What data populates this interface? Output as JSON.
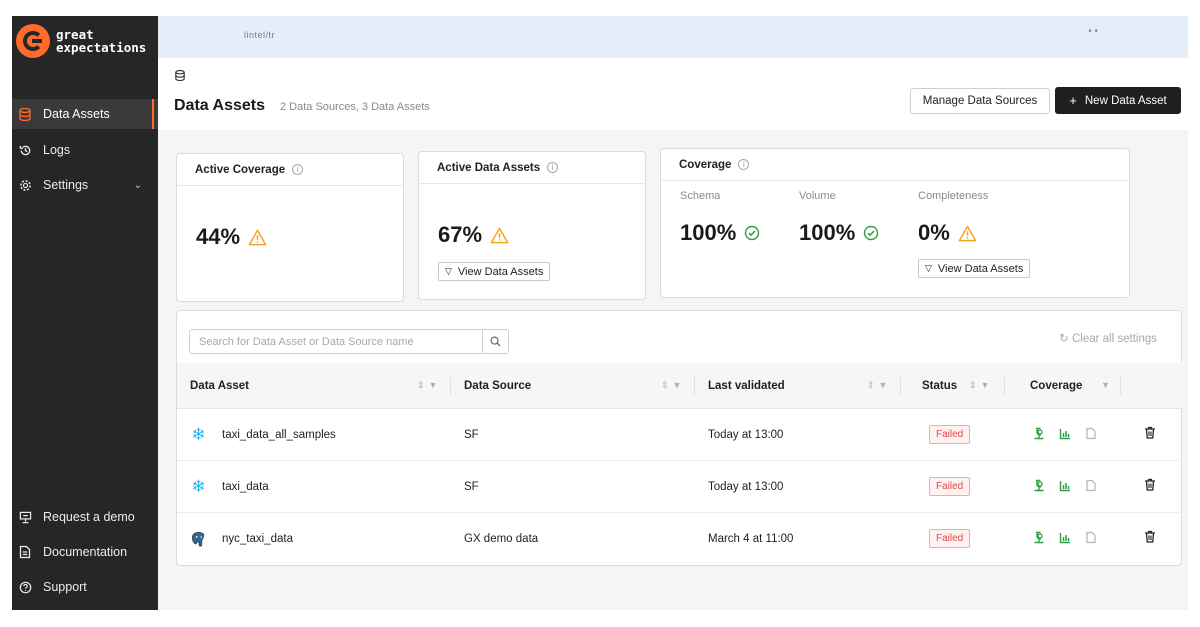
{
  "brand": {
    "line1": "great",
    "line2": "expectations"
  },
  "sidebar": {
    "items": [
      {
        "label": "Data Assets",
        "icon": "database-icon",
        "active": true
      },
      {
        "label": "Logs",
        "icon": "history-icon"
      },
      {
        "label": "Settings",
        "icon": "gear-icon",
        "chevron": "chevron-down-icon"
      }
    ],
    "bottom": [
      {
        "label": "Request a demo",
        "icon": "presentation-icon"
      },
      {
        "label": "Documentation",
        "icon": "document-icon"
      },
      {
        "label": "Support",
        "icon": "help-icon"
      }
    ]
  },
  "topbar": {
    "crumb": "lintel/tr"
  },
  "header": {
    "title": "Data Assets",
    "subtitle": "2 Data Sources, 3 Data Assets",
    "manage_label": "Manage Data Sources",
    "new_label": "New Data Asset",
    "new_plus": "+"
  },
  "cards": {
    "active_coverage": {
      "title": "Active Coverage",
      "value": "44%"
    },
    "active_assets": {
      "title": "Active Data Assets",
      "value": "67%",
      "button": "View Data Assets"
    },
    "coverage": {
      "title": "Coverage",
      "schema_label": "Schema",
      "schema_value": "100%",
      "volume_label": "Volume",
      "volume_value": "100%",
      "completeness_label": "Completeness",
      "completeness_value": "0%",
      "button": "View Data Assets"
    }
  },
  "table": {
    "search_placeholder": "Search for Data Asset or Data Source name",
    "clear_label": "Clear all settings",
    "columns": [
      "Data Asset",
      "Data Source",
      "Last validated",
      "Status",
      "Coverage"
    ],
    "rows": [
      {
        "asset": "taxi_data_all_samples",
        "source": "SF",
        "validated": "Today at 13:00",
        "status": "Failed",
        "icon": "snowflake-icon"
      },
      {
        "asset": "taxi_data",
        "source": "SF",
        "validated": "Today at 13:00",
        "status": "Failed",
        "icon": "snowflake-icon"
      },
      {
        "asset": "nyc_taxi_data",
        "source": "GX demo data",
        "validated": "March 4 at 11:00",
        "status": "Failed",
        "icon": "postgres-icon"
      }
    ]
  },
  "colors": {
    "accent": "#ff6b2c",
    "warning": "#f5a623",
    "success": "#2e9e44",
    "danger": "#e04a4a",
    "sidebar": "#262626"
  }
}
